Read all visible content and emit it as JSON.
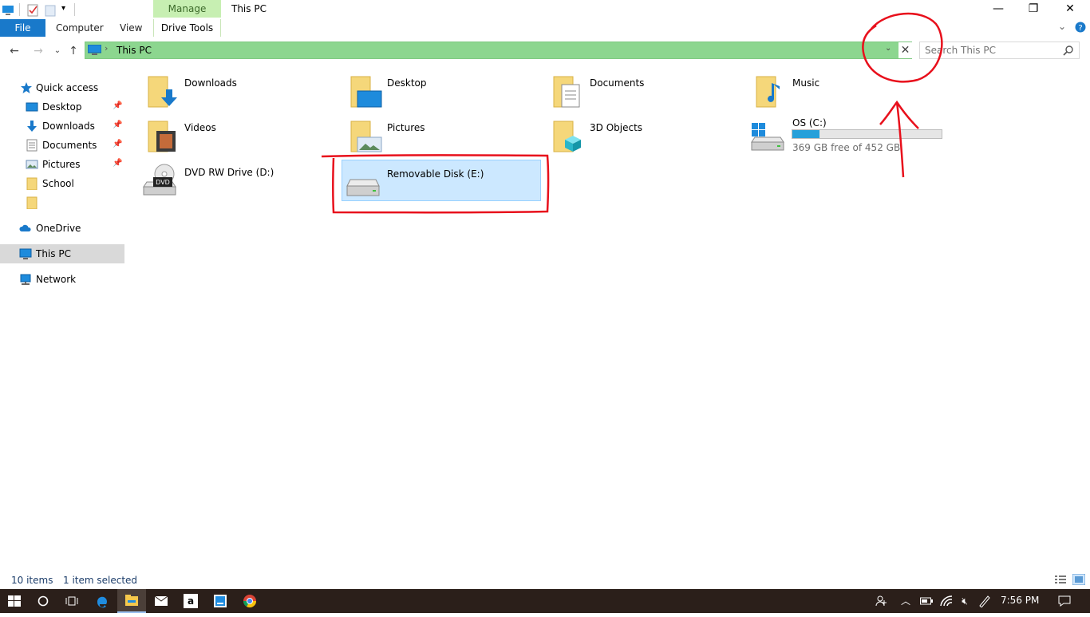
{
  "window": {
    "title": "This PC",
    "manage_tab": "Manage",
    "minimize": "—",
    "restore": "❐",
    "close": "✕"
  },
  "ribbon": {
    "file": "File",
    "computer": "Computer",
    "view": "View",
    "drive_tools": "Drive Tools"
  },
  "address": {
    "separator": "›",
    "path": "This PC",
    "clear": "✕",
    "dropdown": "⌄"
  },
  "search": {
    "placeholder": "Search This PC"
  },
  "nav": {
    "back": "←",
    "forward": "→",
    "recent": "⌄",
    "up": "↑",
    "items": [
      {
        "label": "Quick access"
      },
      {
        "label": "Desktop",
        "pinned": true
      },
      {
        "label": "Downloads",
        "pinned": true
      },
      {
        "label": "Documents",
        "pinned": true
      },
      {
        "label": "Pictures",
        "pinned": true
      },
      {
        "label": "School"
      },
      {
        "label": ""
      },
      {
        "label": "OneDrive"
      },
      {
        "label": "This PC",
        "selected": true
      },
      {
        "label": "Network"
      }
    ]
  },
  "items": [
    {
      "label": "Downloads",
      "icon": "downloads-folder-icon"
    },
    {
      "label": "Desktop",
      "icon": "desktop-folder-icon"
    },
    {
      "label": "Documents",
      "icon": "documents-folder-icon"
    },
    {
      "label": "Music",
      "icon": "music-folder-icon"
    },
    {
      "label": "Videos",
      "icon": "videos-folder-icon"
    },
    {
      "label": "Pictures",
      "icon": "pictures-folder-icon"
    },
    {
      "label": "3D Objects",
      "icon": "3d-objects-folder-icon"
    },
    {
      "label": "OS (C:)",
      "icon": "windows-drive-icon",
      "free_text": "369 GB free of 452 GB",
      "used_fraction": 0.184
    },
    {
      "label": "DVD RW Drive (D:)",
      "icon": "dvd-drive-icon",
      "badge": "DVD"
    },
    {
      "label": "Removable Disk (E:)",
      "icon": "removable-disk-icon",
      "selected": true
    }
  ],
  "status": {
    "count": "10 items",
    "selection": "1 item selected"
  },
  "taskbar": {
    "time": "7:56 PM"
  },
  "colors": {
    "address_bg": "#8cd68f",
    "file_tab": "#1979ca",
    "manage_tab": "#c7efb2",
    "selection": "#cce8ff",
    "annotation": "#e8101c",
    "taskbar": "#2b1f1a"
  }
}
